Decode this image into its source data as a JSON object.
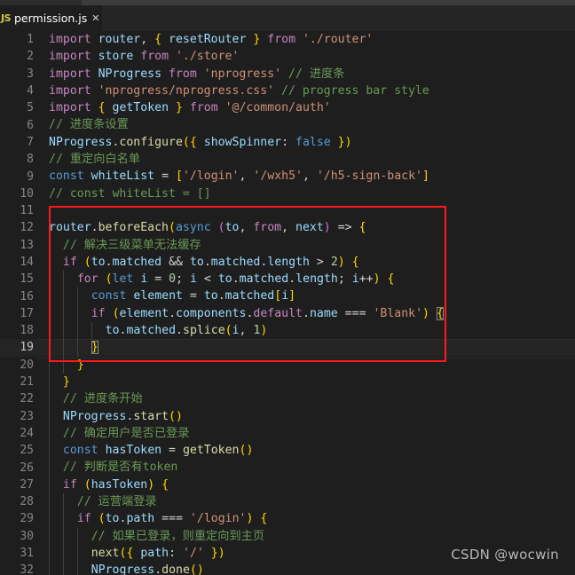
{
  "window": {
    "titlebar_color": "#3c3c3c",
    "editor_background": "#1e1e1e",
    "tabbar_background": "#252526"
  },
  "tabbar": {
    "tabs": [
      {
        "icon": "js-file-icon",
        "icon_text": "JS",
        "icon_color": "#cbcb41",
        "label": "permission.js",
        "close_label": "✕",
        "active": true
      }
    ]
  },
  "annotation": {
    "box_color": "#ff1a1a",
    "covers_lines": "13-21"
  },
  "watermark": {
    "text": "CSDN @wocwin"
  },
  "editor": {
    "language": "javascript",
    "active_line": 19,
    "first_line": 1,
    "last_line": 32,
    "line_numbers": [
      "1",
      "2",
      "3",
      "4",
      "5",
      "6",
      "7",
      "8",
      "9",
      "10",
      "11",
      "12",
      "13",
      "14",
      "15",
      "16",
      "17",
      "18",
      "19",
      "20",
      "21",
      "22",
      "23",
      "24",
      "25",
      "26",
      "27",
      "28",
      "29",
      "30",
      "31",
      "32"
    ],
    "lines": [
      "import router, { resetRouter } from './router'",
      "import store from './store'",
      "import NProgress from 'nprogress' // 进度条",
      "import 'nprogress/nprogress.css' // progress bar style",
      "import { getToken } from '@/common/auth'",
      "// 进度条设置",
      "NProgress.configure({ showSpinner: false })",
      "// 重定向白名单",
      "const whiteList = ['/login', '/wxh5', '/h5-sign-back']",
      "// const whiteList = []",
      "",
      "router.beforeEach(async (to, from, next) => {",
      "  // 解决三级菜单无法缓存",
      "  if (to.matched && to.matched.length > 2) {",
      "    for (let i = 0; i < to.matched.length; i++) {",
      "      const element = to.matched[i]",
      "      if (element.components.default.name === 'Blank') {",
      "        to.matched.splice(i, 1)",
      "      }",
      "    }",
      "  }",
      "  // 进度条开始",
      "  NProgress.start()",
      "  // 确定用户是否已登录",
      "  const hasToken = getToken()",
      "  // 判断是否有token",
      "  if (hasToken) {",
      "    // 运营端登录",
      "    if (to.path === '/login') {",
      "      // 如果已登录，则重定向到主页",
      "      next({ path: '/' })",
      "      NProgress.done()"
    ]
  },
  "colors": {
    "keyword": "#c586c0",
    "storage": "#569cd6",
    "variable": "#9cdcfe",
    "function": "#dcdcaa",
    "string": "#ce9178",
    "number": "#b5cea8",
    "comment": "#6a9955",
    "punctuation": "#d4d4d4",
    "line_number": "#858585",
    "active_line_number": "#c6c6c6"
  }
}
